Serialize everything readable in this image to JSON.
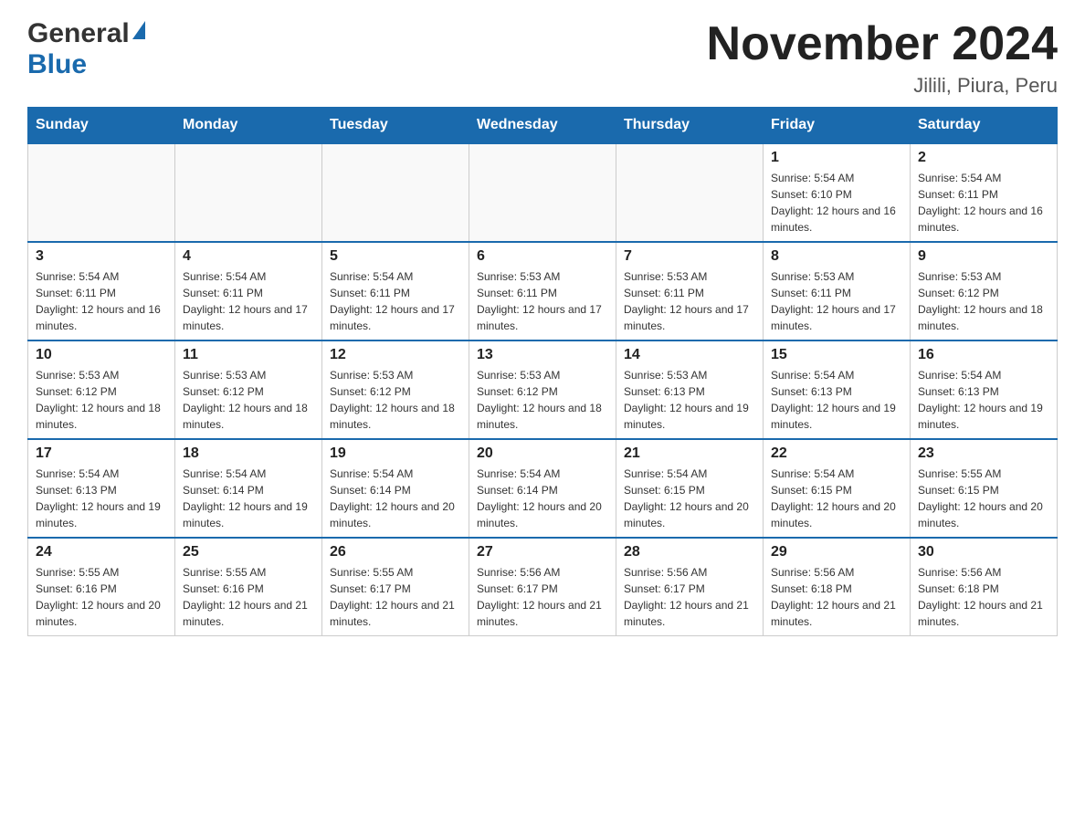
{
  "header": {
    "logo_general": "General",
    "logo_blue": "Blue",
    "title": "November 2024",
    "subtitle": "Jilili, Piura, Peru"
  },
  "weekdays": [
    "Sunday",
    "Monday",
    "Tuesday",
    "Wednesday",
    "Thursday",
    "Friday",
    "Saturday"
  ],
  "weeks": [
    [
      {
        "day": "",
        "sunrise": "",
        "sunset": "",
        "daylight": ""
      },
      {
        "day": "",
        "sunrise": "",
        "sunset": "",
        "daylight": ""
      },
      {
        "day": "",
        "sunrise": "",
        "sunset": "",
        "daylight": ""
      },
      {
        "day": "",
        "sunrise": "",
        "sunset": "",
        "daylight": ""
      },
      {
        "day": "",
        "sunrise": "",
        "sunset": "",
        "daylight": ""
      },
      {
        "day": "1",
        "sunrise": "Sunrise: 5:54 AM",
        "sunset": "Sunset: 6:10 PM",
        "daylight": "Daylight: 12 hours and 16 minutes."
      },
      {
        "day": "2",
        "sunrise": "Sunrise: 5:54 AM",
        "sunset": "Sunset: 6:11 PM",
        "daylight": "Daylight: 12 hours and 16 minutes."
      }
    ],
    [
      {
        "day": "3",
        "sunrise": "Sunrise: 5:54 AM",
        "sunset": "Sunset: 6:11 PM",
        "daylight": "Daylight: 12 hours and 16 minutes."
      },
      {
        "day": "4",
        "sunrise": "Sunrise: 5:54 AM",
        "sunset": "Sunset: 6:11 PM",
        "daylight": "Daylight: 12 hours and 17 minutes."
      },
      {
        "day": "5",
        "sunrise": "Sunrise: 5:54 AM",
        "sunset": "Sunset: 6:11 PM",
        "daylight": "Daylight: 12 hours and 17 minutes."
      },
      {
        "day": "6",
        "sunrise": "Sunrise: 5:53 AM",
        "sunset": "Sunset: 6:11 PM",
        "daylight": "Daylight: 12 hours and 17 minutes."
      },
      {
        "day": "7",
        "sunrise": "Sunrise: 5:53 AM",
        "sunset": "Sunset: 6:11 PM",
        "daylight": "Daylight: 12 hours and 17 minutes."
      },
      {
        "day": "8",
        "sunrise": "Sunrise: 5:53 AM",
        "sunset": "Sunset: 6:11 PM",
        "daylight": "Daylight: 12 hours and 17 minutes."
      },
      {
        "day": "9",
        "sunrise": "Sunrise: 5:53 AM",
        "sunset": "Sunset: 6:12 PM",
        "daylight": "Daylight: 12 hours and 18 minutes."
      }
    ],
    [
      {
        "day": "10",
        "sunrise": "Sunrise: 5:53 AM",
        "sunset": "Sunset: 6:12 PM",
        "daylight": "Daylight: 12 hours and 18 minutes."
      },
      {
        "day": "11",
        "sunrise": "Sunrise: 5:53 AM",
        "sunset": "Sunset: 6:12 PM",
        "daylight": "Daylight: 12 hours and 18 minutes."
      },
      {
        "day": "12",
        "sunrise": "Sunrise: 5:53 AM",
        "sunset": "Sunset: 6:12 PM",
        "daylight": "Daylight: 12 hours and 18 minutes."
      },
      {
        "day": "13",
        "sunrise": "Sunrise: 5:53 AM",
        "sunset": "Sunset: 6:12 PM",
        "daylight": "Daylight: 12 hours and 18 minutes."
      },
      {
        "day": "14",
        "sunrise": "Sunrise: 5:53 AM",
        "sunset": "Sunset: 6:13 PM",
        "daylight": "Daylight: 12 hours and 19 minutes."
      },
      {
        "day": "15",
        "sunrise": "Sunrise: 5:54 AM",
        "sunset": "Sunset: 6:13 PM",
        "daylight": "Daylight: 12 hours and 19 minutes."
      },
      {
        "day": "16",
        "sunrise": "Sunrise: 5:54 AM",
        "sunset": "Sunset: 6:13 PM",
        "daylight": "Daylight: 12 hours and 19 minutes."
      }
    ],
    [
      {
        "day": "17",
        "sunrise": "Sunrise: 5:54 AM",
        "sunset": "Sunset: 6:13 PM",
        "daylight": "Daylight: 12 hours and 19 minutes."
      },
      {
        "day": "18",
        "sunrise": "Sunrise: 5:54 AM",
        "sunset": "Sunset: 6:14 PM",
        "daylight": "Daylight: 12 hours and 19 minutes."
      },
      {
        "day": "19",
        "sunrise": "Sunrise: 5:54 AM",
        "sunset": "Sunset: 6:14 PM",
        "daylight": "Daylight: 12 hours and 20 minutes."
      },
      {
        "day": "20",
        "sunrise": "Sunrise: 5:54 AM",
        "sunset": "Sunset: 6:14 PM",
        "daylight": "Daylight: 12 hours and 20 minutes."
      },
      {
        "day": "21",
        "sunrise": "Sunrise: 5:54 AM",
        "sunset": "Sunset: 6:15 PM",
        "daylight": "Daylight: 12 hours and 20 minutes."
      },
      {
        "day": "22",
        "sunrise": "Sunrise: 5:54 AM",
        "sunset": "Sunset: 6:15 PM",
        "daylight": "Daylight: 12 hours and 20 minutes."
      },
      {
        "day": "23",
        "sunrise": "Sunrise: 5:55 AM",
        "sunset": "Sunset: 6:15 PM",
        "daylight": "Daylight: 12 hours and 20 minutes."
      }
    ],
    [
      {
        "day": "24",
        "sunrise": "Sunrise: 5:55 AM",
        "sunset": "Sunset: 6:16 PM",
        "daylight": "Daylight: 12 hours and 20 minutes."
      },
      {
        "day": "25",
        "sunrise": "Sunrise: 5:55 AM",
        "sunset": "Sunset: 6:16 PM",
        "daylight": "Daylight: 12 hours and 21 minutes."
      },
      {
        "day": "26",
        "sunrise": "Sunrise: 5:55 AM",
        "sunset": "Sunset: 6:17 PM",
        "daylight": "Daylight: 12 hours and 21 minutes."
      },
      {
        "day": "27",
        "sunrise": "Sunrise: 5:56 AM",
        "sunset": "Sunset: 6:17 PM",
        "daylight": "Daylight: 12 hours and 21 minutes."
      },
      {
        "day": "28",
        "sunrise": "Sunrise: 5:56 AM",
        "sunset": "Sunset: 6:17 PM",
        "daylight": "Daylight: 12 hours and 21 minutes."
      },
      {
        "day": "29",
        "sunrise": "Sunrise: 5:56 AM",
        "sunset": "Sunset: 6:18 PM",
        "daylight": "Daylight: 12 hours and 21 minutes."
      },
      {
        "day": "30",
        "sunrise": "Sunrise: 5:56 AM",
        "sunset": "Sunset: 6:18 PM",
        "daylight": "Daylight: 12 hours and 21 minutes."
      }
    ]
  ]
}
